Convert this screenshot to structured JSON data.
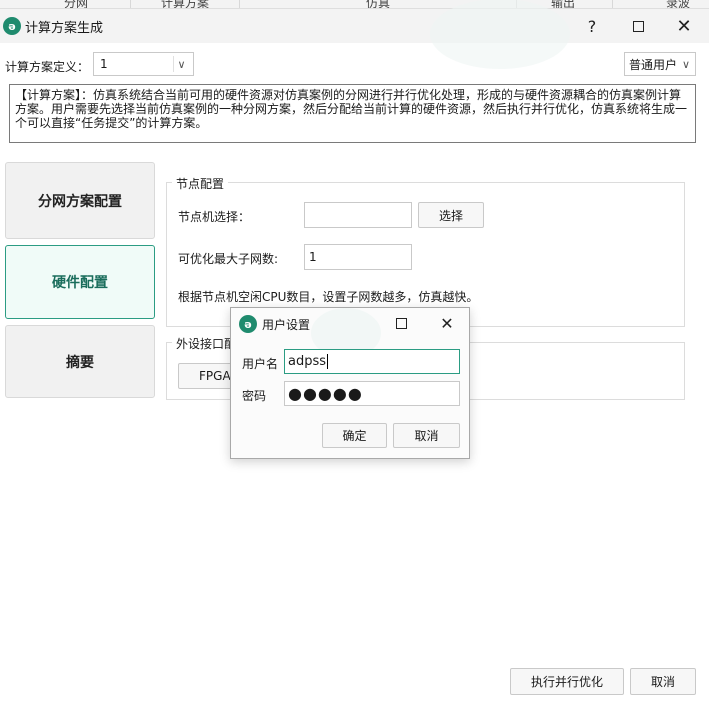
{
  "background_window": {
    "column_headers": [
      "分网",
      "计算方案",
      "仿真",
      "输出",
      "录波"
    ]
  },
  "window": {
    "title": "计算方案生成",
    "help_icon": "?",
    "maximize_icon": "maximize-icon",
    "close_icon": "✕"
  },
  "scheme": {
    "label": "计算方案定义：",
    "value": "1",
    "user_role": "普通用户"
  },
  "description": "【计算方案】：仿真系统结合当前可用的硬件资源对仿真案例的分网进行并行优化处理，形成的与硬件资源耦合的仿真案例计算方案。用户需要先选择当前仿真案例的一种分网方案，然后分配给当前计算的硬件资源，然后执行并行优化，仿真系统将生成一个可以直接“任务提交”的计算方案。",
  "nav": {
    "items": [
      {
        "label": "分网方案配置",
        "active": false
      },
      {
        "label": "硬件配置",
        "active": true
      },
      {
        "label": "摘要",
        "active": false
      }
    ]
  },
  "node_config": {
    "group_title": "节点配置",
    "node_select_label": "节点机选择：",
    "node_select_value": "",
    "select_button": "选择",
    "max_subnets_label": "可优化最大子网数:",
    "max_subnets_value": "1",
    "hint": "根据节点机空闲CPU数目，设置子网数越多，仿真越快。"
  },
  "peripheral": {
    "group_title": "外设接口配",
    "fpga_button": "FPGA"
  },
  "footer": {
    "optimize_button": "执行并行优化",
    "cancel_button": "取消"
  },
  "dialog": {
    "title": "用户设置",
    "username_label": "用户名",
    "username_value": "adpss",
    "password_label": "密码",
    "password_mask": "●●●●●",
    "ok_button": "确定",
    "cancel_button": "取消"
  },
  "colors": {
    "accent": "#2b9c83",
    "logo": "#1f8b6e",
    "titlebar": "#f3f3f3"
  }
}
